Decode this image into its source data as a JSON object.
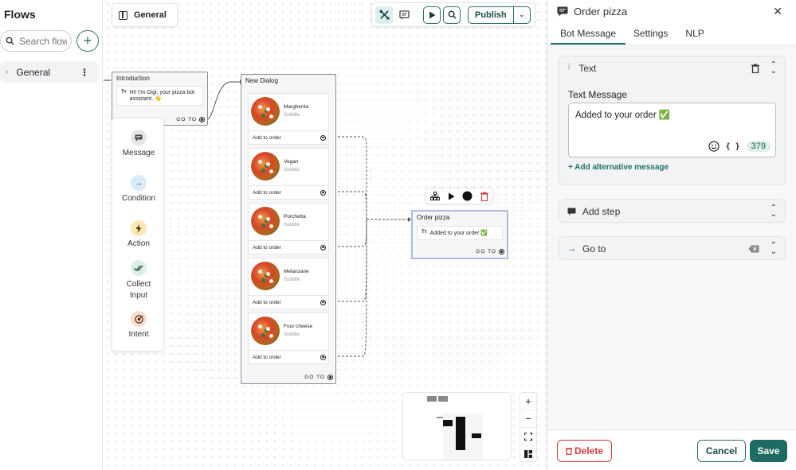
{
  "sidebar": {
    "title": "Flows",
    "search_placeholder": "Search flows",
    "add_label": "+",
    "items": [
      {
        "label": "General"
      }
    ]
  },
  "canvas": {
    "flow_tab": "General",
    "toolbar": {
      "publish_label": "Publish"
    },
    "intro_node": {
      "title": "Introduction",
      "message": "Hi! I'm Gigi, your pizza bot assistant. 👋",
      "goto": "GO TO"
    },
    "dialog_node": {
      "title": "New Dialog",
      "goto": "GO TO",
      "cards": [
        {
          "title": "Margherita",
          "subtitle": "Subtitle",
          "button": "Add to order"
        },
        {
          "title": "Vegan",
          "subtitle": "Subtitle",
          "button": "Add to order"
        },
        {
          "title": "Porchetta",
          "subtitle": "Subtitle",
          "button": "Add to order"
        },
        {
          "title": "Melanzane",
          "subtitle": "Subtitle",
          "button": "Add to order"
        },
        {
          "title": "Four cheese",
          "subtitle": "Subtitle",
          "button": "Add to order"
        }
      ]
    },
    "order_node": {
      "title": "Order pizza",
      "message": "Added to your order ✅",
      "goto": "GO TO"
    },
    "palette": [
      {
        "label": "Message",
        "color": "#e4e6e9",
        "icon": "message-icon"
      },
      {
        "label": "Condition",
        "color": "#d7ecf8",
        "icon": "arrow-right-icon"
      },
      {
        "label": "Action",
        "color": "#fbe7b8",
        "icon": "bolt-icon"
      },
      {
        "label": "Collect Input",
        "color": "#dcefe3",
        "icon": "double-check-icon"
      },
      {
        "label": "Intent",
        "color": "#fcdcc8",
        "icon": "target-icon"
      }
    ]
  },
  "panel": {
    "title": "Order pizza",
    "tabs": [
      "Bot Message",
      "Settings",
      "NLP"
    ],
    "text_section": {
      "header": "Text",
      "field_label": "Text Message",
      "value": "Added to your order ✅",
      "char_count": "379",
      "variables_glyph": "{ }",
      "add_alt": "+ Add alternative message"
    },
    "add_step": "Add step",
    "go_to": "Go to",
    "footer": {
      "delete": "Delete",
      "cancel": "Cancel",
      "save": "Save"
    }
  },
  "colors": {
    "accent": "#1e6b64",
    "danger": "#d03b3b"
  }
}
